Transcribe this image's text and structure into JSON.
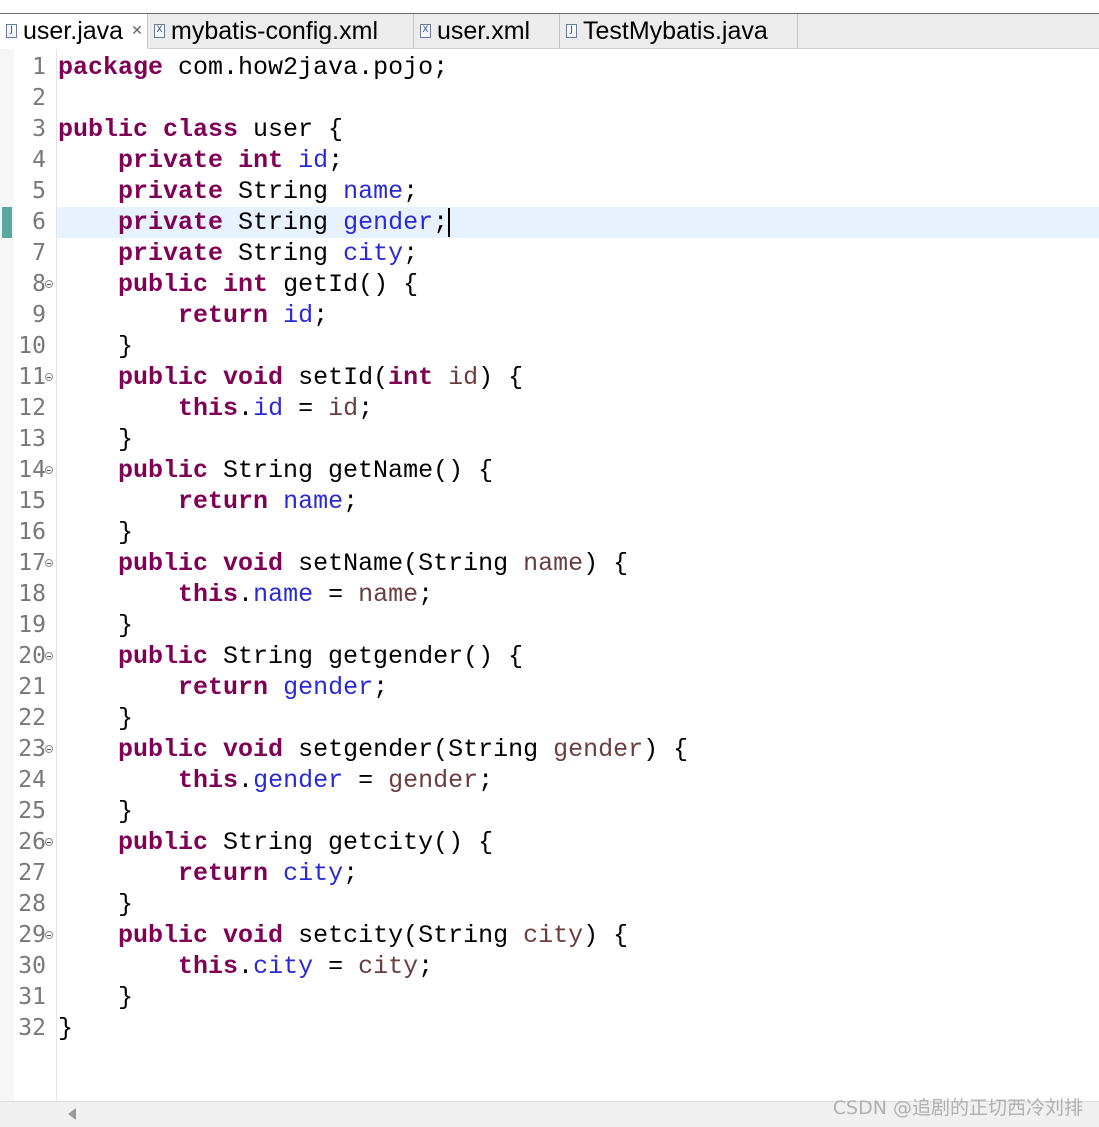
{
  "tabs": [
    {
      "label": "user.java",
      "icon": "java-file-icon",
      "icon_glyph": "J",
      "active": true,
      "closable": true
    },
    {
      "label": "mybatis-config.xml",
      "icon": "xml-file-icon",
      "icon_glyph": "X",
      "active": false,
      "closable": false
    },
    {
      "label": "user.xml",
      "icon": "xml-file-icon",
      "icon_glyph": "X",
      "active": false,
      "closable": false
    },
    {
      "label": "TestMybatis.java",
      "icon": "java-file-icon",
      "icon_glyph": "J",
      "active": false,
      "closable": false
    }
  ],
  "editor": {
    "current_line": 6,
    "lines": [
      {
        "n": "1",
        "tokens": [
          [
            "kw",
            "package"
          ],
          [
            "pl",
            " com.how2java.pojo;"
          ]
        ]
      },
      {
        "n": "2",
        "tokens": []
      },
      {
        "n": "3",
        "tokens": [
          [
            "kw",
            "public"
          ],
          [
            "pl",
            " "
          ],
          [
            "kw",
            "class"
          ],
          [
            "pl",
            " user {"
          ]
        ]
      },
      {
        "n": "4",
        "tokens": [
          [
            "pl",
            "    "
          ],
          [
            "kw",
            "private"
          ],
          [
            "pl",
            " "
          ],
          [
            "kw",
            "int"
          ],
          [
            "pl",
            " "
          ],
          [
            "fd",
            "id"
          ],
          [
            "pl",
            ";"
          ]
        ]
      },
      {
        "n": "5",
        "tokens": [
          [
            "pl",
            "    "
          ],
          [
            "kw",
            "private"
          ],
          [
            "pl",
            " String "
          ],
          [
            "fd",
            "name"
          ],
          [
            "pl",
            ";"
          ]
        ]
      },
      {
        "n": "6",
        "tokens": [
          [
            "pl",
            "    "
          ],
          [
            "kw",
            "private"
          ],
          [
            "pl",
            " String "
          ],
          [
            "fd",
            "gender"
          ],
          [
            "pl",
            ";"
          ]
        ]
      },
      {
        "n": "7",
        "tokens": [
          [
            "pl",
            "    "
          ],
          [
            "kw",
            "private"
          ],
          [
            "pl",
            " String "
          ],
          [
            "fd",
            "city"
          ],
          [
            "pl",
            ";"
          ]
        ]
      },
      {
        "n": "8",
        "fold": true,
        "tokens": [
          [
            "pl",
            "    "
          ],
          [
            "kw",
            "public"
          ],
          [
            "pl",
            " "
          ],
          [
            "kw",
            "int"
          ],
          [
            "pl",
            " getId() {"
          ]
        ]
      },
      {
        "n": "9",
        "tokens": [
          [
            "pl",
            "        "
          ],
          [
            "kw",
            "return"
          ],
          [
            "pl",
            " "
          ],
          [
            "fd",
            "id"
          ],
          [
            "pl",
            ";"
          ]
        ]
      },
      {
        "n": "10",
        "tokens": [
          [
            "pl",
            "    }"
          ]
        ]
      },
      {
        "n": "11",
        "fold": true,
        "tokens": [
          [
            "pl",
            "    "
          ],
          [
            "kw",
            "public"
          ],
          [
            "pl",
            " "
          ],
          [
            "kw",
            "void"
          ],
          [
            "pl",
            " setId("
          ],
          [
            "kw",
            "int"
          ],
          [
            "pl",
            " "
          ],
          [
            "pm",
            "id"
          ],
          [
            "pl",
            ") {"
          ]
        ]
      },
      {
        "n": "12",
        "tokens": [
          [
            "pl",
            "        "
          ],
          [
            "kw",
            "this"
          ],
          [
            "pl",
            "."
          ],
          [
            "fd",
            "id"
          ],
          [
            "pl",
            " = "
          ],
          [
            "pm",
            "id"
          ],
          [
            "pl",
            ";"
          ]
        ]
      },
      {
        "n": "13",
        "tokens": [
          [
            "pl",
            "    }"
          ]
        ]
      },
      {
        "n": "14",
        "fold": true,
        "tokens": [
          [
            "pl",
            "    "
          ],
          [
            "kw",
            "public"
          ],
          [
            "pl",
            " String getName() {"
          ]
        ]
      },
      {
        "n": "15",
        "tokens": [
          [
            "pl",
            "        "
          ],
          [
            "kw",
            "return"
          ],
          [
            "pl",
            " "
          ],
          [
            "fd",
            "name"
          ],
          [
            "pl",
            ";"
          ]
        ]
      },
      {
        "n": "16",
        "tokens": [
          [
            "pl",
            "    }"
          ]
        ]
      },
      {
        "n": "17",
        "fold": true,
        "tokens": [
          [
            "pl",
            "    "
          ],
          [
            "kw",
            "public"
          ],
          [
            "pl",
            " "
          ],
          [
            "kw",
            "void"
          ],
          [
            "pl",
            " setName(String "
          ],
          [
            "pm",
            "name"
          ],
          [
            "pl",
            ") {"
          ]
        ]
      },
      {
        "n": "18",
        "tokens": [
          [
            "pl",
            "        "
          ],
          [
            "kw",
            "this"
          ],
          [
            "pl",
            "."
          ],
          [
            "fd",
            "name"
          ],
          [
            "pl",
            " = "
          ],
          [
            "pm",
            "name"
          ],
          [
            "pl",
            ";"
          ]
        ]
      },
      {
        "n": "19",
        "tokens": [
          [
            "pl",
            "    }"
          ]
        ]
      },
      {
        "n": "20",
        "fold": true,
        "tokens": [
          [
            "pl",
            "    "
          ],
          [
            "kw",
            "public"
          ],
          [
            "pl",
            " String getgender() {"
          ]
        ]
      },
      {
        "n": "21",
        "tokens": [
          [
            "pl",
            "        "
          ],
          [
            "kw",
            "return"
          ],
          [
            "pl",
            " "
          ],
          [
            "fd",
            "gender"
          ],
          [
            "pl",
            ";"
          ]
        ]
      },
      {
        "n": "22",
        "tokens": [
          [
            "pl",
            "    }"
          ]
        ]
      },
      {
        "n": "23",
        "fold": true,
        "tokens": [
          [
            "pl",
            "    "
          ],
          [
            "kw",
            "public"
          ],
          [
            "pl",
            " "
          ],
          [
            "kw",
            "void"
          ],
          [
            "pl",
            " setgender(String "
          ],
          [
            "pm",
            "gender"
          ],
          [
            "pl",
            ") {"
          ]
        ]
      },
      {
        "n": "24",
        "tokens": [
          [
            "pl",
            "        "
          ],
          [
            "kw",
            "this"
          ],
          [
            "pl",
            "."
          ],
          [
            "fd",
            "gender"
          ],
          [
            "pl",
            " = "
          ],
          [
            "pm",
            "gender"
          ],
          [
            "pl",
            ";"
          ]
        ]
      },
      {
        "n": "25",
        "tokens": [
          [
            "pl",
            "    }"
          ]
        ]
      },
      {
        "n": "26",
        "fold": true,
        "tokens": [
          [
            "pl",
            "    "
          ],
          [
            "kw",
            "public"
          ],
          [
            "pl",
            " String getcity() {"
          ]
        ]
      },
      {
        "n": "27",
        "tokens": [
          [
            "pl",
            "        "
          ],
          [
            "kw",
            "return"
          ],
          [
            "pl",
            " "
          ],
          [
            "fd",
            "city"
          ],
          [
            "pl",
            ";"
          ]
        ]
      },
      {
        "n": "28",
        "tokens": [
          [
            "pl",
            "    }"
          ]
        ]
      },
      {
        "n": "29",
        "fold": true,
        "tokens": [
          [
            "pl",
            "    "
          ],
          [
            "kw",
            "public"
          ],
          [
            "pl",
            " "
          ],
          [
            "kw",
            "void"
          ],
          [
            "pl",
            " setcity(String "
          ],
          [
            "pm",
            "city"
          ],
          [
            "pl",
            ") {"
          ]
        ]
      },
      {
        "n": "30",
        "tokens": [
          [
            "pl",
            "        "
          ],
          [
            "kw",
            "this"
          ],
          [
            "pl",
            "."
          ],
          [
            "fd",
            "city"
          ],
          [
            "pl",
            " = "
          ],
          [
            "pm",
            "city"
          ],
          [
            "pl",
            ";"
          ]
        ]
      },
      {
        "n": "31",
        "tokens": [
          [
            "pl",
            "    }"
          ]
        ]
      },
      {
        "n": "32",
        "tokens": [
          [
            "pl",
            "}"
          ]
        ]
      }
    ]
  },
  "colors": {
    "keyword": "#7f0055",
    "field": "#2a2ad4",
    "parameter": "#6a3e3e",
    "current_line_bg": "#e8f2fe",
    "change_marker": "#5aa8a0"
  },
  "watermark": "CSDN @追剧的正切西冷刘排"
}
